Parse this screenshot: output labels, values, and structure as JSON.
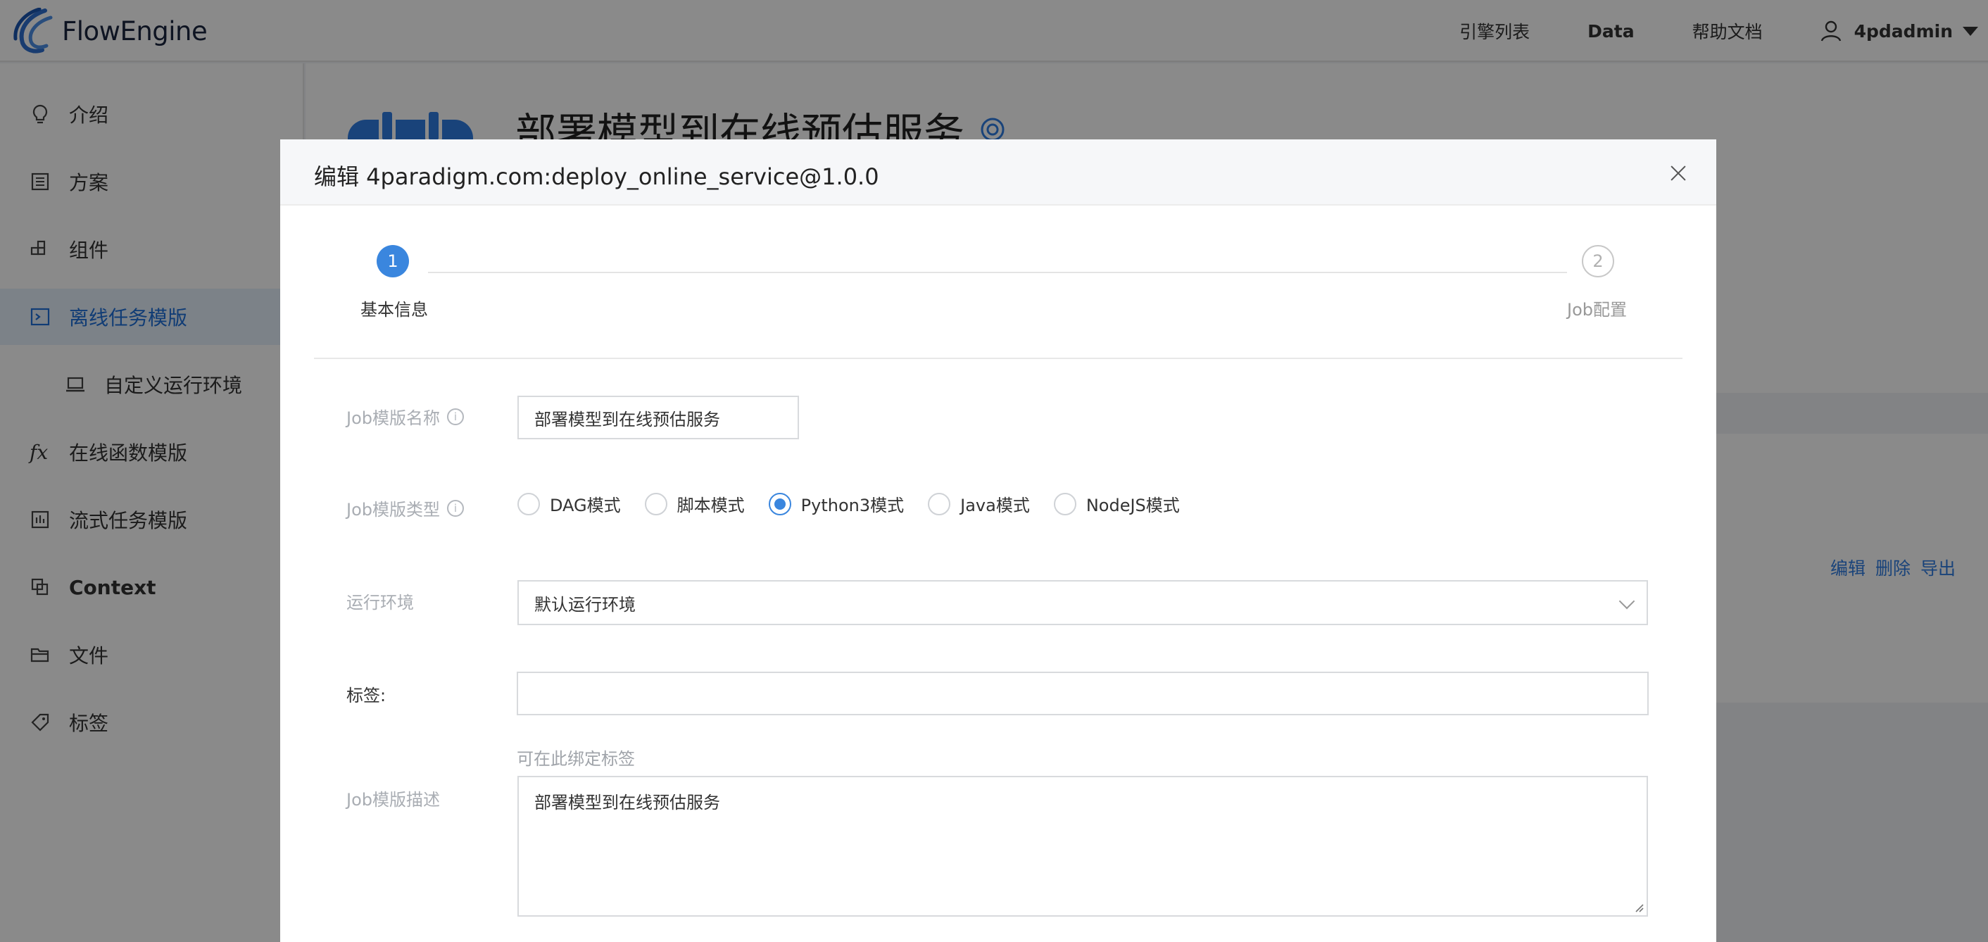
{
  "header": {
    "logo_text": "FlowEngine",
    "nav": [
      "引擎列表",
      "Data",
      "帮助文档"
    ],
    "username": "4pdadmin"
  },
  "sidebar": {
    "items": [
      {
        "label": "介绍",
        "icon": "lightbulb-icon"
      },
      {
        "label": "方案",
        "icon": "list-icon"
      },
      {
        "label": "组件",
        "icon": "component-icon"
      },
      {
        "label": "离线任务模版",
        "icon": "terminal-icon",
        "active": true
      },
      {
        "label": "自定义运行环境",
        "icon": "laptop-icon",
        "sub": true
      },
      {
        "label": "在线函数模版",
        "icon": "fx-icon"
      },
      {
        "label": "流式任务模版",
        "icon": "stream-icon"
      },
      {
        "label": "Context",
        "icon": "context-icon"
      },
      {
        "label": "文件",
        "icon": "folder-icon"
      },
      {
        "label": "标签",
        "icon": "tag-icon"
      }
    ]
  },
  "page": {
    "title": "部署模型到在线预估服务",
    "ops": [
      "编辑",
      "删除",
      "导出"
    ]
  },
  "modal": {
    "title": "编辑 4paradigm.com:deploy_online_service@1.0.0",
    "steps": [
      {
        "num": "1",
        "label": "基本信息",
        "state": "active"
      },
      {
        "num": "2",
        "label": "Job配置",
        "state": "pending"
      }
    ],
    "form": {
      "name_label": "Job模版名称",
      "name_value": "部署模型到在线预估服务",
      "type_label": "Job模版类型",
      "type_options": [
        "DAG模式",
        "脚本模式",
        "Python3模式",
        "Java模式",
        "NodeJS模式"
      ],
      "type_selected": "Python3模式",
      "env_label": "运行环境",
      "env_value": "默认运行环境",
      "tags_label": "标签:",
      "tags_value": "",
      "tags_hint": "可在此绑定标签",
      "desc_label": "Job模版描述",
      "desc_value": "部署模型到在线预估服务"
    }
  },
  "colors": {
    "accent": "#3a86de",
    "link": "#2f7de1",
    "active_bg": "#e6f0fc"
  }
}
